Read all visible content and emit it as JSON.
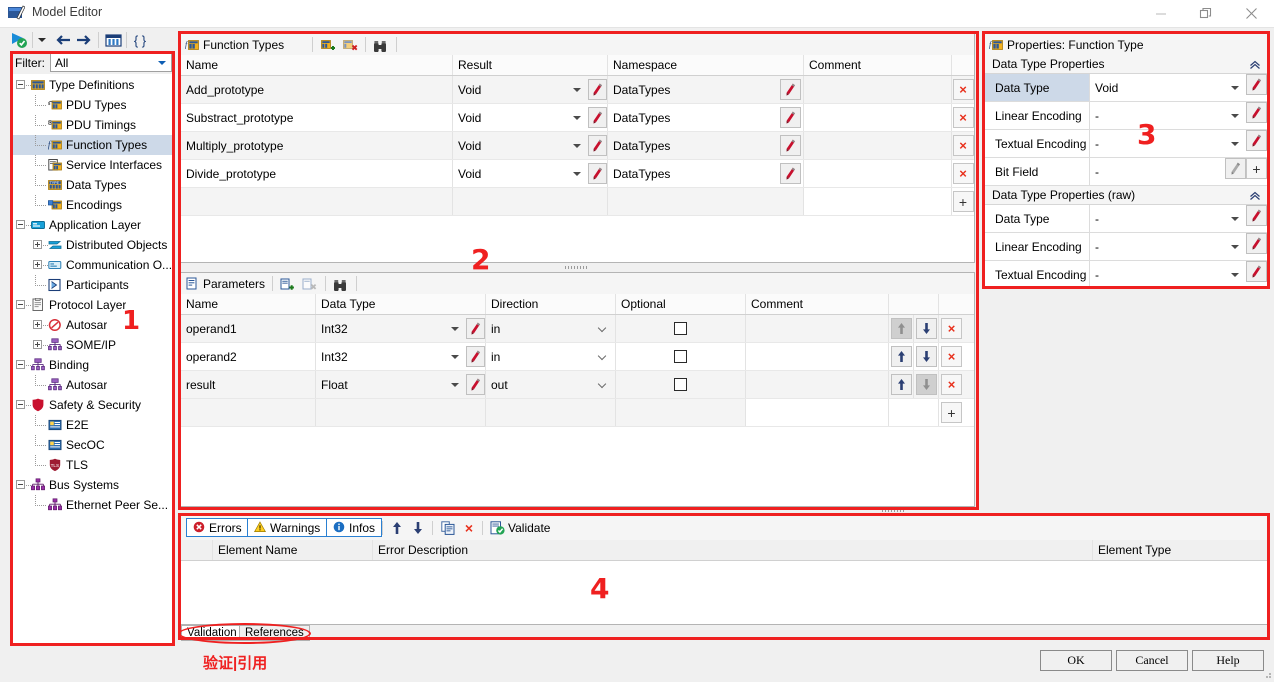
{
  "window": {
    "title": "Model Editor",
    "minimize_label": "Minimize",
    "maximize_label": "Restore",
    "close_label": "Close"
  },
  "toolbar": {
    "items": [
      {
        "name": "run-validate-icon",
        "label": "Run"
      },
      {
        "name": "dropdown-arrow-icon",
        "label": ""
      },
      {
        "name": "back-arrow-icon",
        "label": "Back"
      },
      {
        "name": "forward-arrow-icon",
        "label": "Forward"
      },
      {
        "name": "columns-icon",
        "label": "Columns"
      },
      {
        "name": "braces-icon",
        "label": "{}"
      }
    ]
  },
  "sidebar": {
    "filter": {
      "label": "Filter:",
      "value": "All",
      "placeholder": "All"
    },
    "tree": [
      {
        "label": "Type Definitions",
        "depth": 0,
        "expander": "minus",
        "icon": "type-definitions-icon",
        "selected": false
      },
      {
        "label": "PDU Types",
        "depth": 1,
        "expander": "none",
        "icon": "pdu-types-icon",
        "selected": false
      },
      {
        "label": "PDU Timings",
        "depth": 1,
        "expander": "none",
        "icon": "pdu-timings-icon",
        "selected": false
      },
      {
        "label": "Function Types",
        "depth": 1,
        "expander": "none",
        "icon": "function-types-icon",
        "selected": true
      },
      {
        "label": "Service Interfaces",
        "depth": 1,
        "expander": "none",
        "icon": "service-interfaces-icon",
        "selected": false
      },
      {
        "label": "Data Types",
        "depth": 1,
        "expander": "none",
        "icon": "data-types-icon",
        "selected": false
      },
      {
        "label": "Encodings",
        "depth": 1,
        "expander": "none",
        "icon": "encodings-icon",
        "selected": false
      },
      {
        "label": "Application Layer",
        "depth": 0,
        "expander": "minus",
        "icon": "application-layer-icon",
        "selected": false
      },
      {
        "label": "Distributed Objects",
        "depth": 1,
        "expander": "plus",
        "icon": "distributed-objects-icon",
        "selected": false
      },
      {
        "label": "Communication O...",
        "depth": 1,
        "expander": "plus",
        "icon": "communication-objects-icon",
        "selected": false
      },
      {
        "label": "Participants",
        "depth": 1,
        "expander": "none",
        "icon": "participants-icon",
        "selected": false
      },
      {
        "label": "Protocol Layer",
        "depth": 0,
        "expander": "minus",
        "icon": "protocol-layer-icon",
        "selected": false
      },
      {
        "label": "Autosar",
        "depth": 1,
        "expander": "plus",
        "icon": "autosar-icon",
        "selected": false
      },
      {
        "label": "SOME/IP",
        "depth": 1,
        "expander": "plus",
        "icon": "someip-icon",
        "selected": false
      },
      {
        "label": "Binding",
        "depth": 0,
        "expander": "minus",
        "icon": "binding-icon",
        "selected": false
      },
      {
        "label": "Autosar",
        "depth": 1,
        "expander": "none",
        "icon": "someip-icon",
        "selected": false
      },
      {
        "label": "Safety & Security",
        "depth": 0,
        "expander": "minus",
        "icon": "safety-security-icon",
        "selected": false
      },
      {
        "label": "E2E",
        "depth": 1,
        "expander": "none",
        "icon": "e2e-icon",
        "selected": false
      },
      {
        "label": "SecOC",
        "depth": 1,
        "expander": "none",
        "icon": "secoc-icon",
        "selected": false
      },
      {
        "label": "TLS",
        "depth": 1,
        "expander": "none",
        "icon": "tls-icon",
        "selected": false
      },
      {
        "label": "Bus Systems",
        "depth": 0,
        "expander": "minus",
        "icon": "bus-systems-icon",
        "selected": false
      },
      {
        "label": "Ethernet Peer Se...",
        "depth": 1,
        "expander": "none",
        "icon": "bus-systems-icon",
        "selected": false
      }
    ]
  },
  "function_types": {
    "tab_label": "Function Types",
    "tab_icon": "function-types-icon",
    "toolbar": [
      {
        "name": "add-function-type-button",
        "label": "Add"
      },
      {
        "name": "delete-function-type-button",
        "label": "Delete"
      },
      {
        "name": "find-button",
        "label": "Find"
      }
    ],
    "columns": [
      "Name",
      "Result",
      "Namespace",
      "Comment"
    ],
    "rows": [
      {
        "name": "Add_prototype",
        "result": "Void",
        "namespace": "DataTypes",
        "comment": ""
      },
      {
        "name": "Substract_prototype",
        "result": "Void",
        "namespace": "DataTypes",
        "comment": ""
      },
      {
        "name": "Multiply_prototype",
        "result": "Void",
        "namespace": "DataTypes",
        "comment": ""
      },
      {
        "name": "Divide_prototype",
        "result": "Void",
        "namespace": "DataTypes",
        "comment": ""
      }
    ],
    "add_row_label": "+",
    "delete_row_label": "×"
  },
  "parameters": {
    "tab_label": "Parameters",
    "tab_icon": "parameters-icon",
    "toolbar": [
      {
        "name": "add-parameter-button",
        "label": "Add"
      },
      {
        "name": "delete-parameter-button",
        "label": "Delete"
      },
      {
        "name": "find-button",
        "label": "Find"
      }
    ],
    "columns": [
      "Name",
      "Data Type",
      "Direction",
      "Optional",
      "Comment"
    ],
    "rows": [
      {
        "name": "operand1",
        "data_type": "Int32",
        "direction": "in",
        "optional": false,
        "comment": "",
        "up_enabled": false,
        "down_enabled": true
      },
      {
        "name": "operand2",
        "data_type": "Int32",
        "direction": "in",
        "optional": false,
        "comment": "",
        "up_enabled": true,
        "down_enabled": true
      },
      {
        "name": "result",
        "data_type": "Float",
        "direction": "out",
        "optional": false,
        "comment": "",
        "up_enabled": true,
        "down_enabled": false
      }
    ],
    "move_up_label": "↑",
    "move_down_label": "↓",
    "add_row_label": "+",
    "delete_row_label": "×"
  },
  "properties": {
    "tab_label": "Properties: Function Type",
    "tab_icon": "function-types-icon",
    "groups": [
      {
        "title": "Data Type Properties",
        "collapse_icon": "chevron-up-icon",
        "rows": [
          {
            "label": "Data Type",
            "value": "Void",
            "selected": true,
            "has_caret": true,
            "has_pencil": true,
            "has_plus": false,
            "pencil_enabled": true
          },
          {
            "label": "Linear Encoding",
            "value": "-",
            "selected": false,
            "has_caret": true,
            "has_pencil": true,
            "has_plus": false,
            "pencil_enabled": true
          },
          {
            "label": "Textual Encoding",
            "value": "-",
            "selected": false,
            "has_caret": true,
            "has_pencil": true,
            "has_plus": false,
            "pencil_enabled": true
          },
          {
            "label": "Bit Field",
            "value": "-",
            "selected": false,
            "has_caret": false,
            "has_pencil": true,
            "has_plus": true,
            "pencil_enabled": false
          }
        ]
      },
      {
        "title": "Data Type Properties (raw)",
        "collapse_icon": "chevron-up-icon",
        "rows": [
          {
            "label": "Data Type",
            "value": "-",
            "selected": false,
            "has_caret": true,
            "has_pencil": true,
            "has_plus": false,
            "pencil_enabled": true
          },
          {
            "label": "Linear Encoding",
            "value": "-",
            "selected": false,
            "has_caret": true,
            "has_pencil": true,
            "has_plus": false,
            "pencil_enabled": true
          },
          {
            "label": "Textual Encoding",
            "value": "-",
            "selected": false,
            "has_caret": true,
            "has_pencil": true,
            "has_plus": false,
            "pencil_enabled": true
          }
        ]
      }
    ]
  },
  "validation": {
    "tabs": [
      {
        "label": "Errors",
        "icon": "error-icon",
        "active": true
      },
      {
        "label": "Warnings",
        "icon": "warning-icon",
        "active": true
      },
      {
        "label": "Infos",
        "icon": "info-icon",
        "active": true
      }
    ],
    "toolbar": [
      {
        "name": "move-up-button",
        "label": "↑"
      },
      {
        "name": "move-down-button",
        "label": "↓"
      },
      {
        "name": "copy-button",
        "label": "Copy"
      },
      {
        "name": "clear-button",
        "label": "×"
      },
      {
        "name": "validate-button",
        "label": "Validate"
      }
    ],
    "columns": [
      "Element Name",
      "Error Description",
      "Element Type"
    ],
    "rows": []
  },
  "bottom_tabs": [
    {
      "label": "Validation",
      "active": true
    },
    {
      "label": "References",
      "active": false
    }
  ],
  "dialog_buttons": [
    {
      "label": "OK",
      "name": "ok-button"
    },
    {
      "label": "Cancel",
      "name": "cancel-button"
    },
    {
      "label": "Help",
      "name": "help-button"
    }
  ],
  "annotations": {
    "numbers": [
      "1",
      "2",
      "3",
      "4"
    ],
    "caption": "验证|引用",
    "color": "#ef2020"
  }
}
